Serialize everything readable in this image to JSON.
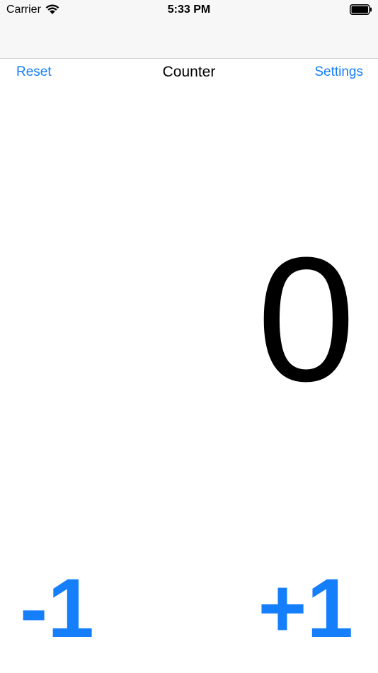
{
  "status_bar": {
    "carrier": "Carrier",
    "time": "5:33 PM",
    "wifi_icon": "wifi-icon",
    "battery_icon": "battery-icon"
  },
  "toolbar": {
    "reset_label": "Reset",
    "title": "Counter",
    "settings_label": "Settings"
  },
  "counter": {
    "value": "0"
  },
  "controls": {
    "decrement_label": "-1",
    "increment_label": "+1"
  },
  "colors": {
    "accent": "#157efb",
    "text": "#000000",
    "chrome_background": "#f7f7f7"
  }
}
